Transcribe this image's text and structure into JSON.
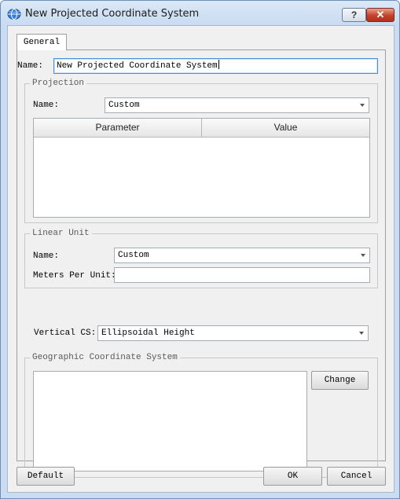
{
  "window": {
    "title": "New Projected Coordinate System",
    "help_label": "?",
    "close_label": "✕"
  },
  "tabs": [
    {
      "label": "General",
      "selected": true
    }
  ],
  "general": {
    "name_label": "Name:",
    "name_value": "New Projected Coordinate System",
    "projection": {
      "group_title": "Projection",
      "name_label": "Name:",
      "name_value": "Custom",
      "columns": [
        "Parameter",
        "Value"
      ],
      "rows": []
    },
    "linear_unit": {
      "group_title": "Linear Unit",
      "name_label": "Name:",
      "name_value": "Custom",
      "meters_label": "Meters Per Unit:",
      "meters_value": ""
    },
    "vertical_cs": {
      "label": "Vertical CS:",
      "value": "Ellipsoidal Height"
    },
    "geographic_cs": {
      "group_title": "Geographic Coordinate System",
      "change_label": "Change",
      "description": ""
    }
  },
  "footer": {
    "default_label": "Default",
    "ok_label": "OK",
    "cancel_label": "Cancel"
  },
  "colors": {
    "title_bar": "#c9dcf1",
    "close_button": "#c3412b",
    "dialog_background": "#f0f0f0",
    "focus_border": "#4a90d9"
  },
  "icons": {
    "app": "globe-app-icon",
    "dropdown": "chevron-down-icon"
  }
}
